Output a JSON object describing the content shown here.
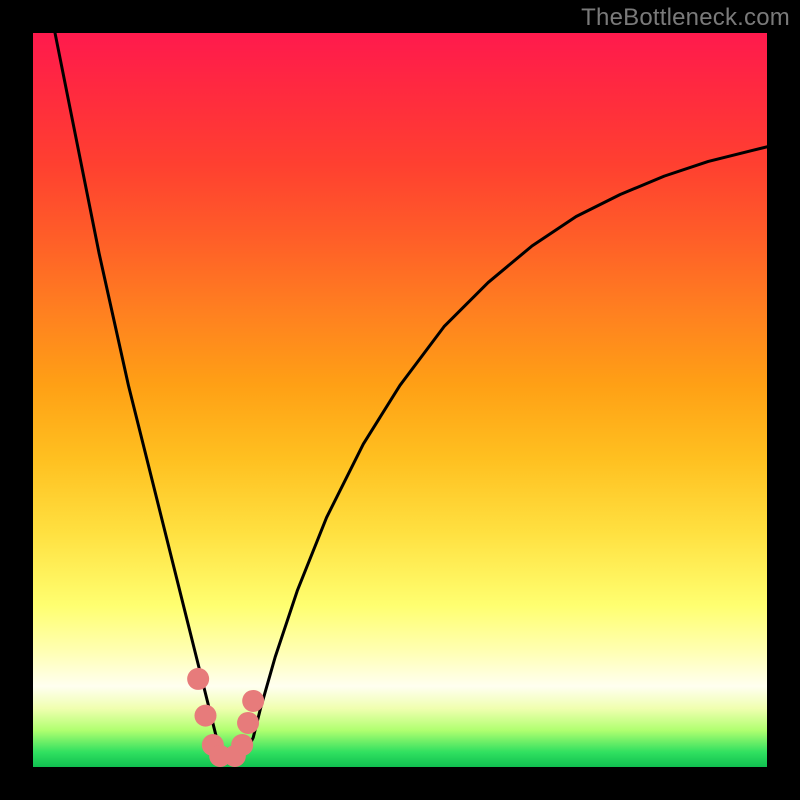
{
  "watermark": "TheBottleneck.com",
  "chart_data": {
    "type": "line",
    "title": "",
    "xlabel": "",
    "ylabel": "",
    "grid": false,
    "xlim": [
      0,
      100
    ],
    "ylim": [
      0,
      100
    ],
    "curve": {
      "name": "bottleneck-curve",
      "x": [
        3,
        5,
        7,
        9,
        11,
        13,
        15,
        17,
        19,
        21,
        22,
        23,
        24,
        25,
        26,
        27,
        28,
        29,
        30,
        31,
        33,
        36,
        40,
        45,
        50,
        56,
        62,
        68,
        74,
        80,
        86,
        92,
        98,
        100
      ],
      "y": [
        100,
        90,
        80,
        70,
        61,
        52,
        44,
        36,
        28,
        20,
        16,
        12,
        8,
        4,
        2,
        1,
        1,
        2,
        4,
        8,
        15,
        24,
        34,
        44,
        52,
        60,
        66,
        71,
        75,
        78,
        80.5,
        82.5,
        84,
        84.5
      ]
    },
    "markers": {
      "name": "highlight-points",
      "color": "#e77b7b",
      "points": [
        {
          "x": 22.5,
          "y": 12
        },
        {
          "x": 23.5,
          "y": 7
        },
        {
          "x": 24.5,
          "y": 3
        },
        {
          "x": 25.5,
          "y": 1.5
        },
        {
          "x": 27.5,
          "y": 1.5
        },
        {
          "x": 28.5,
          "y": 3
        },
        {
          "x": 29.3,
          "y": 6
        },
        {
          "x": 30.0,
          "y": 9
        }
      ]
    }
  }
}
